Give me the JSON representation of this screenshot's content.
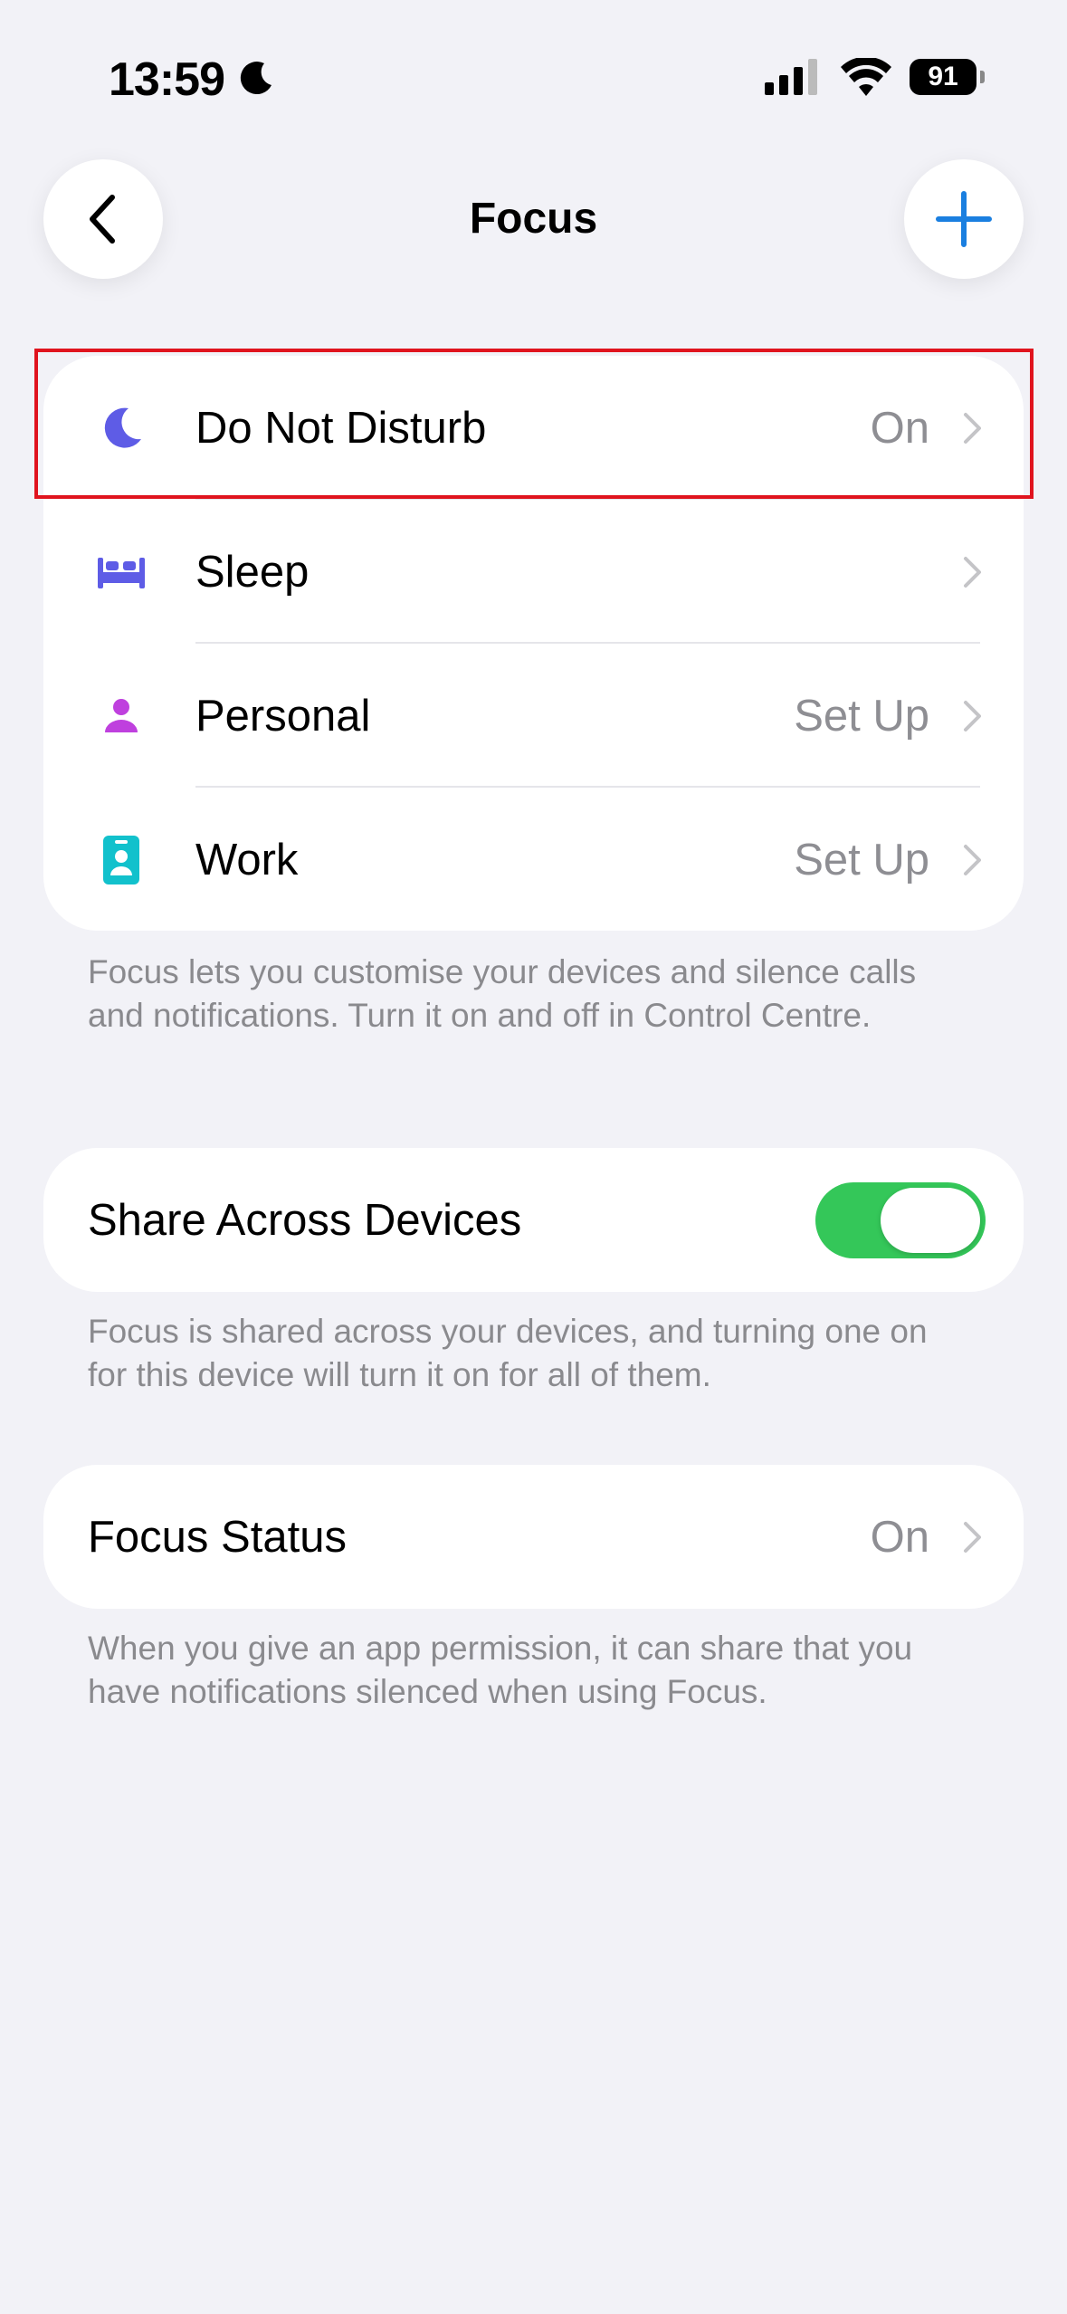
{
  "status_bar": {
    "time": "13:59",
    "battery": "91"
  },
  "nav": {
    "title": "Focus",
    "back_icon": "chevron-left-icon",
    "add_icon": "plus-icon"
  },
  "focus_modes": [
    {
      "label": "Do Not Disturb",
      "value": "On",
      "icon": "moon-icon",
      "color": "#5E5CE6"
    },
    {
      "label": "Sleep",
      "value": "",
      "icon": "bed-icon",
      "color": "#5E5CE6"
    },
    {
      "label": "Personal",
      "value": "Set Up",
      "icon": "person-icon",
      "color": "#BF40DE"
    },
    {
      "label": "Work",
      "value": "Set Up",
      "icon": "id-badge-icon",
      "color": "#12C1CC"
    }
  ],
  "focus_footnote": "Focus lets you customise your devices and silence calls and notifications. Turn it on and off in Control Centre.",
  "share": {
    "label": "Share Across Devices",
    "enabled": true,
    "footnote": "Focus is shared across your devices, and turning one on for this device will turn it on for all of them."
  },
  "focus_status": {
    "label": "Focus Status",
    "value": "On",
    "footnote": "When you give an app permission, it can share that you have notifications silenced when using Focus."
  },
  "colors": {
    "accent_blue": "#1A7FE0",
    "toggle_green": "#34C759",
    "highlight_red": "#E0141E"
  }
}
